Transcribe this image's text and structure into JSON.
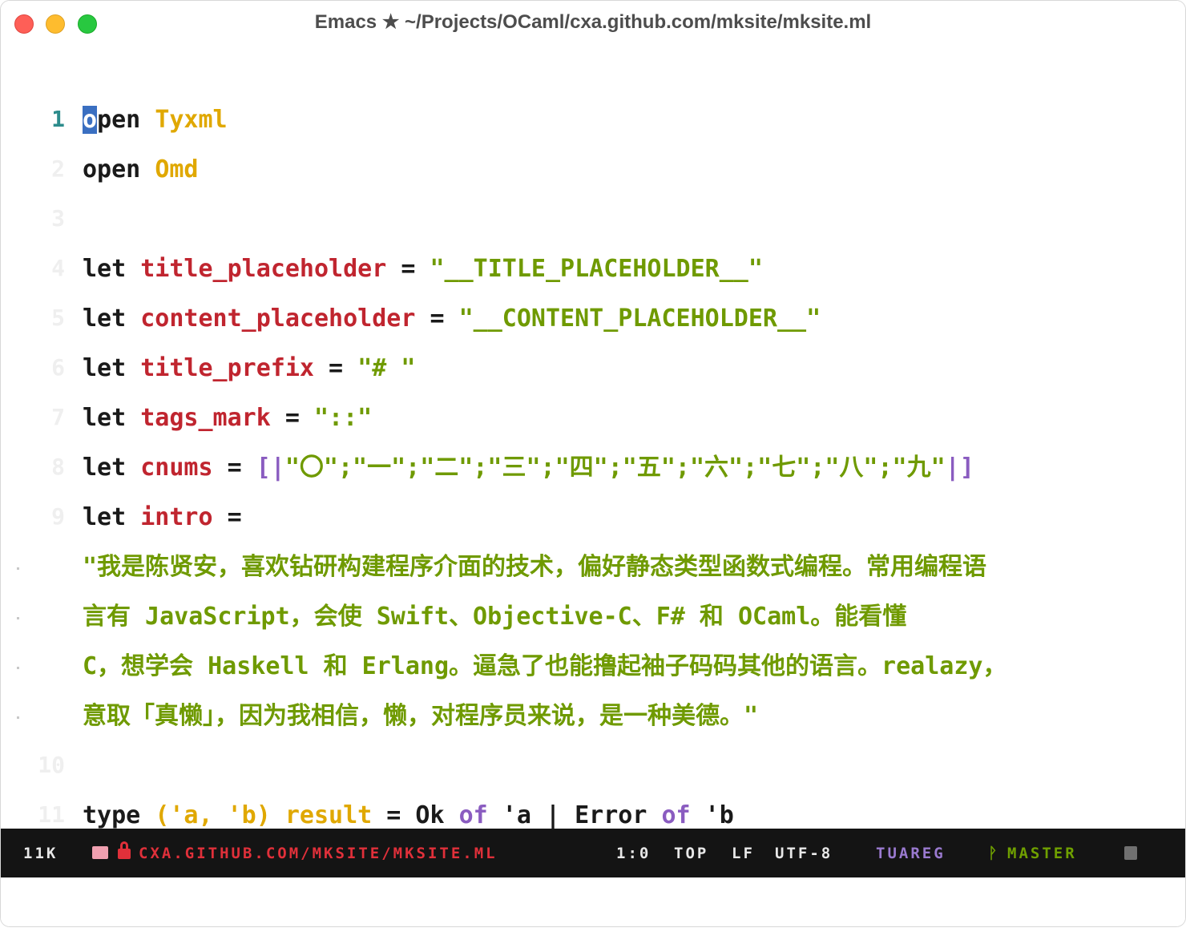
{
  "window": {
    "title": "Emacs ★ ~/Projects/OCaml/cxa.github.com/mksite/mksite.ml"
  },
  "editor": {
    "lines": [
      {
        "num": "1",
        "tokens": [
          [
            "cursor",
            "o"
          ],
          [
            "kw",
            "pen "
          ],
          [
            "mod",
            "Tyxml"
          ]
        ]
      },
      {
        "num": "2",
        "tokens": [
          [
            "kw",
            "open "
          ],
          [
            "mod",
            "Omd"
          ]
        ]
      },
      {
        "num": "3",
        "tokens": []
      },
      {
        "num": "4",
        "tokens": [
          [
            "kw",
            "let "
          ],
          [
            "var",
            "title_placeholder"
          ],
          [
            "op",
            " = "
          ],
          [
            "str",
            "\"__TITLE_PLACEHOLDER__\""
          ]
        ]
      },
      {
        "num": "5",
        "tokens": [
          [
            "kw",
            "let "
          ],
          [
            "var",
            "content_placeholder"
          ],
          [
            "op",
            " = "
          ],
          [
            "str",
            "\"__CONTENT_PLACEHOLDER__\""
          ]
        ]
      },
      {
        "num": "6",
        "tokens": [
          [
            "kw",
            "let "
          ],
          [
            "var",
            "title_prefix"
          ],
          [
            "op",
            " = "
          ],
          [
            "str",
            "\"# \""
          ]
        ]
      },
      {
        "num": "7",
        "tokens": [
          [
            "kw",
            "let "
          ],
          [
            "var",
            "tags_mark"
          ],
          [
            "op",
            " = "
          ],
          [
            "str",
            "\"::\""
          ]
        ]
      },
      {
        "num": "8",
        "tokens": [
          [
            "kw",
            "let "
          ],
          [
            "var",
            "cnums"
          ],
          [
            "op",
            " = "
          ],
          [
            "brk",
            "[|"
          ],
          [
            "str",
            "\"〇\";\"一\";\"二\";\"三\";\"四\";\"五\";\"六\";\"七\";\"八\";\"九\""
          ],
          [
            "brk",
            "|]"
          ]
        ]
      },
      {
        "num": "9",
        "tokens": [
          [
            "kw",
            "let "
          ],
          [
            "var",
            "intro"
          ],
          [
            "op",
            " ="
          ]
        ]
      },
      {
        "num": "",
        "wrap": true,
        "tokens": [
          [
            "str",
            "\"我是陈贤安，喜欢钻研构建程序介面的技术，偏好静态类型函数式编程。常用编程语"
          ]
        ]
      },
      {
        "num": "",
        "wrap": true,
        "tokens": [
          [
            "str",
            "言有 JavaScript，会使 Swift、Objective-C、F# 和 OCaml。能看懂"
          ]
        ]
      },
      {
        "num": "",
        "wrap": true,
        "tokens": [
          [
            "str",
            "C，想学会 Haskell 和 Erlang。逼急了也能撸起袖子码码其他的语言。realazy，"
          ]
        ]
      },
      {
        "num": "",
        "wrap": true,
        "tokens": [
          [
            "str",
            "意取「真懒」，因为我相信，懒，对程序员来说，是一种美德。\""
          ]
        ]
      },
      {
        "num": "10",
        "tokens": []
      },
      {
        "num": "11",
        "tokens": [
          [
            "kw",
            "type "
          ],
          [
            "mod",
            "('a, 'b) result"
          ],
          [
            "op",
            " = Ok "
          ],
          [
            "of",
            "of"
          ],
          [
            "op",
            " 'a | Error "
          ],
          [
            "of",
            "of"
          ],
          [
            "op",
            " 'b"
          ]
        ]
      }
    ]
  },
  "modeline": {
    "size": "11K",
    "file": "CXA.GITHUB.COM/MKSITE/MKSITE.ML",
    "position": "1:0",
    "scroll": "TOP",
    "eol": "LF",
    "encoding": "UTF-8",
    "mode": "TUAREG",
    "branch_icon": "git-branch-icon",
    "branch": "MASTER"
  },
  "colors": {
    "keyword": "#1a1a1a",
    "module": "#e0a800",
    "variable": "#c0252f",
    "string": "#6f9a00",
    "bracket": "#8a5cc0",
    "cursor": "#3a6fc1",
    "modeline_bg": "#141414"
  }
}
